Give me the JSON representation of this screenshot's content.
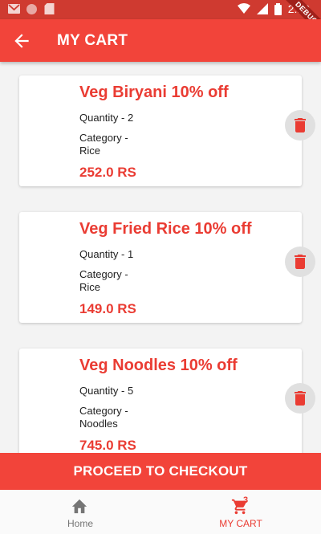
{
  "status_bar": {
    "time": "2:19",
    "debug_label": "DEBUG"
  },
  "app_bar": {
    "title": "MY CART"
  },
  "cart": {
    "items": [
      {
        "name": "Veg Biryani 10% off",
        "quantity": "Quantity - 2",
        "category_label": "Category -",
        "category": "Rice",
        "price": "252.0 RS"
      },
      {
        "name": "Veg Fried Rice 10% off",
        "quantity": "Quantity - 1",
        "category_label": "Category -",
        "category": "Rice",
        "price": "149.0 RS"
      },
      {
        "name": "Veg Noodles 10% off",
        "quantity": "Quantity - 5",
        "category_label": "Category -",
        "category": "Noodles",
        "price": "745.0 RS"
      }
    ]
  },
  "checkout": {
    "label": "PROCEED TO CHECKOUT"
  },
  "bottom_nav": {
    "home_label": "Home",
    "cart_label": "MY CART",
    "cart_badge": "3"
  },
  "colors": {
    "accent": "#f2443a",
    "status_bar": "#cf3a30",
    "text_accent": "#ea3c33"
  }
}
